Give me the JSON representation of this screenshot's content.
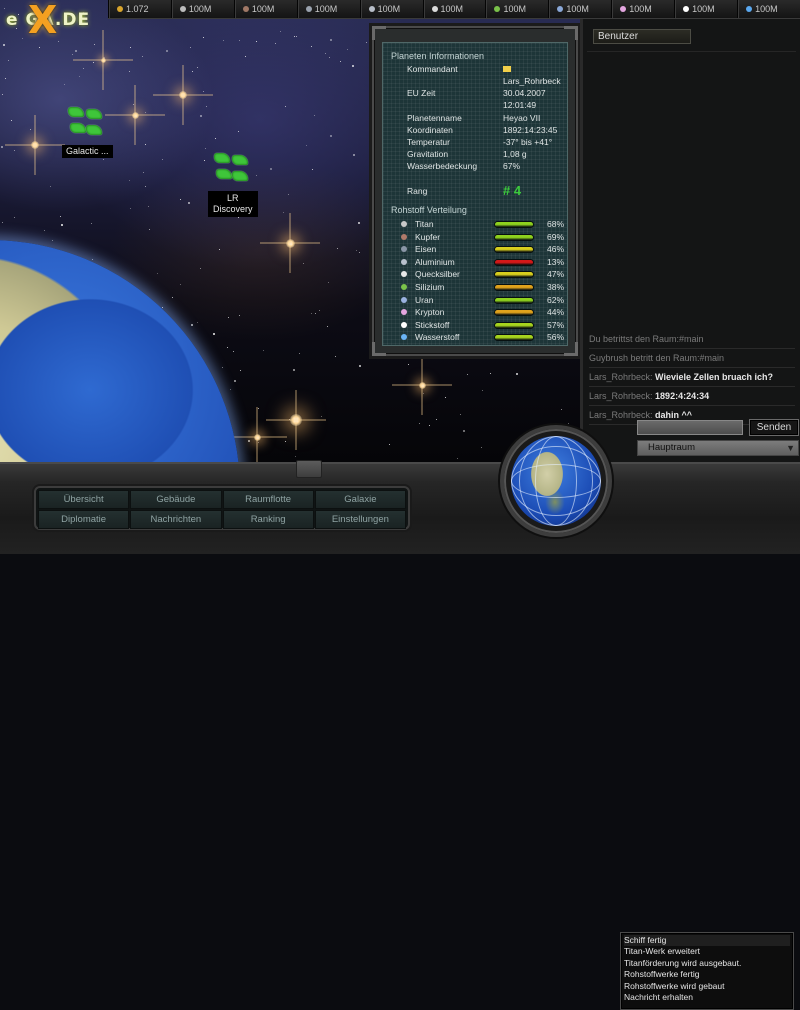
{
  "logo": {
    "x": "X",
    "text": "e  GA.DE"
  },
  "resources": [
    {
      "name": "credits",
      "icon": "coin-icon",
      "value": "1.072",
      "color": "#d9a52c"
    },
    {
      "name": "titan",
      "icon": "titan-icon",
      "value": "100M",
      "color": "#bdbdbd"
    },
    {
      "name": "kupfer",
      "icon": "kupfer-icon",
      "value": "100M",
      "color": "#a07866"
    },
    {
      "name": "eisen",
      "icon": "eisen-icon",
      "value": "100M",
      "color": "#9aa2ae"
    },
    {
      "name": "aluminium",
      "icon": "aluminium-icon",
      "value": "100M",
      "color": "#b8bec8"
    },
    {
      "name": "quecksilber",
      "icon": "quecksilber-icon",
      "value": "100M",
      "color": "#dcdcdc"
    },
    {
      "name": "silizium",
      "icon": "silizium-icon",
      "value": "100M",
      "color": "#7ac24a"
    },
    {
      "name": "uran",
      "icon": "uran-icon",
      "value": "100M",
      "color": "#8aa8d8"
    },
    {
      "name": "krypton",
      "icon": "krypton-icon",
      "value": "100M",
      "color": "#e4a6e0"
    },
    {
      "name": "stickstoff",
      "icon": "stickstoff-icon",
      "value": "100M",
      "color": "#ffffff"
    },
    {
      "name": "wasserstoff",
      "icon": "wasserstoff-icon",
      "value": "100M",
      "color": "#5aa8f0"
    }
  ],
  "map": {
    "fleets": [
      {
        "label": "Galactic ..."
      },
      {
        "label": "LR\nDiscovery"
      }
    ]
  },
  "planet_info": {
    "title": "Planeten Informationen",
    "rows": [
      {
        "key": "Kommandant",
        "value": ""
      },
      {
        "key": "",
        "value": "Lars_Rohrbeck"
      },
      {
        "key": "EU Zeit",
        "value": "30.04.2007"
      },
      {
        "key": "",
        "value": "12:01:49"
      },
      {
        "key": "Planetenname",
        "value": "Heyao VII"
      },
      {
        "key": "Koordinaten",
        "value": "1892:14:23:45"
      },
      {
        "key": "Temperatur",
        "value": "-37° bis +41°"
      },
      {
        "key": "Gravitation",
        "value": "1,08 g"
      },
      {
        "key": "Wasserbedeckung",
        "value": "67%"
      }
    ],
    "rank_label": "Rang",
    "rank_value": "# 4",
    "resources_title": "Rohstoff Verteilung",
    "resources": [
      {
        "name": "Titan",
        "percent": 68,
        "pct_label": "68%",
        "bar_color": "#8ed21e",
        "icon_color": "#c8c8c8"
      },
      {
        "name": "Kupfer",
        "percent": 69,
        "pct_label": "69%",
        "bar_color": "#8ed21e",
        "icon_color": "#b07a6a"
      },
      {
        "name": "Eisen",
        "percent": 46,
        "pct_label": "46%",
        "bar_color": "#d8cf1e",
        "icon_color": "#8a96a6"
      },
      {
        "name": "Aluminium",
        "percent": 13,
        "pct_label": "13%",
        "bar_color": "#d41818",
        "icon_color": "#b8c0cc"
      },
      {
        "name": "Quecksilber",
        "percent": 47,
        "pct_label": "47%",
        "bar_color": "#d8cf1e",
        "icon_color": "#e8e8e8"
      },
      {
        "name": "Silizium",
        "percent": 38,
        "pct_label": "38%",
        "bar_color": "#e0a21c",
        "icon_color": "#7ac24a"
      },
      {
        "name": "Uran",
        "percent": 62,
        "pct_label": "62%",
        "bar_color": "#8ed21e",
        "icon_color": "#9ab2e0"
      },
      {
        "name": "Krypton",
        "percent": 44,
        "pct_label": "44%",
        "bar_color": "#e0a21c",
        "icon_color": "#e4a6e0"
      },
      {
        "name": "Stickstoff",
        "percent": 57,
        "pct_label": "57%",
        "bar_color": "#a6d41e",
        "icon_color": "#ffffff"
      },
      {
        "name": "Wasserstoff",
        "percent": 56,
        "pct_label": "56%",
        "bar_color": "#a6d41e",
        "icon_color": "#6ab4f4"
      }
    ]
  },
  "chat": {
    "users_button": "Benutzer",
    "messages": [
      {
        "who": "",
        "text": "Du betrittst den Raum:#main",
        "system": true
      },
      {
        "who": "",
        "text": "Guybrush betritt den Raum:#main",
        "system": true
      },
      {
        "who": "Lars_Rohrbeck: ",
        "text": "Wieviele Zellen bruach ich?",
        "system": false
      },
      {
        "who": "Lars_Rohrbeck: ",
        "text": "1892:4:24:34",
        "system": false
      },
      {
        "who": "Lars_Rohrbeck: ",
        "text": "dahin ^^",
        "system": false
      }
    ],
    "input_value": "",
    "send_label": "Senden",
    "room_selected": "Hauptraum"
  },
  "nav": {
    "buttons": [
      "Übersicht",
      "Gebäude",
      "Raumflotte",
      "Galaxie",
      "Diplomatie",
      "Nachrichten",
      "Ranking",
      "Einstellungen"
    ]
  },
  "event_log": [
    "Schiff fertig",
    "Titan-Werk erweitert",
    "Titanförderung wird ausgebaut.",
    "Rohstoffwerke fertig",
    "Rohstoffwerke wird gebaut",
    "Nachricht erhalten"
  ]
}
